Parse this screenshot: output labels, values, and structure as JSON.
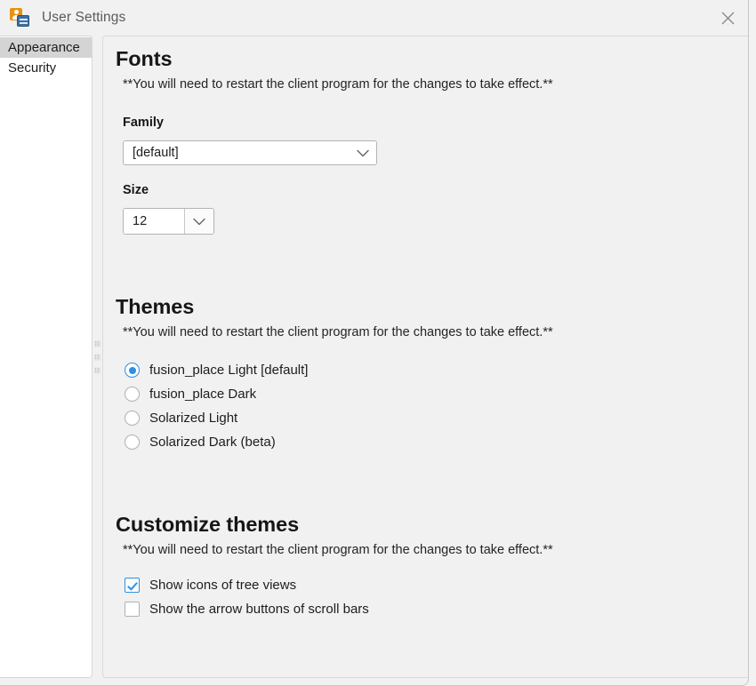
{
  "window": {
    "title": "User Settings",
    "app_icon": "user-settings-icon",
    "close_label": "×"
  },
  "sidebar": {
    "items": [
      {
        "label": "Appearance",
        "selected": true
      },
      {
        "label": "Security",
        "selected": false
      }
    ]
  },
  "content": {
    "restart_note": "**You will need to restart the client program for the changes to take effect.**",
    "fonts": {
      "title": "Fonts",
      "family": {
        "label": "Family",
        "value": "[default]",
        "arrow_icon": "chevron-down-icon"
      },
      "size": {
        "label": "Size",
        "value": "12",
        "arrow_icon": "chevron-down-icon"
      }
    },
    "themes": {
      "title": "Themes",
      "options": [
        {
          "label": "fusion_place Light [default]",
          "checked": true
        },
        {
          "label": "fusion_place Dark",
          "checked": false
        },
        {
          "label": "Solarized Light",
          "checked": false
        },
        {
          "label": "Solarized Dark (beta)",
          "checked": false
        }
      ]
    },
    "customize": {
      "title": "Customize themes",
      "options": [
        {
          "label": "Show icons of tree views",
          "checked": true
        },
        {
          "label": "Show the arrow buttons of scroll bars",
          "checked": false
        }
      ]
    }
  },
  "colors": {
    "accent": "#2f8fe0",
    "titlebar_bg": "#f1f1f1",
    "pane_bg": "#f1f1f1",
    "sidebar_bg": "#ffffff",
    "selection_bg": "#d4d4d4",
    "icon_orange": "#e8920f",
    "icon_blue": "#3d6fa5"
  }
}
